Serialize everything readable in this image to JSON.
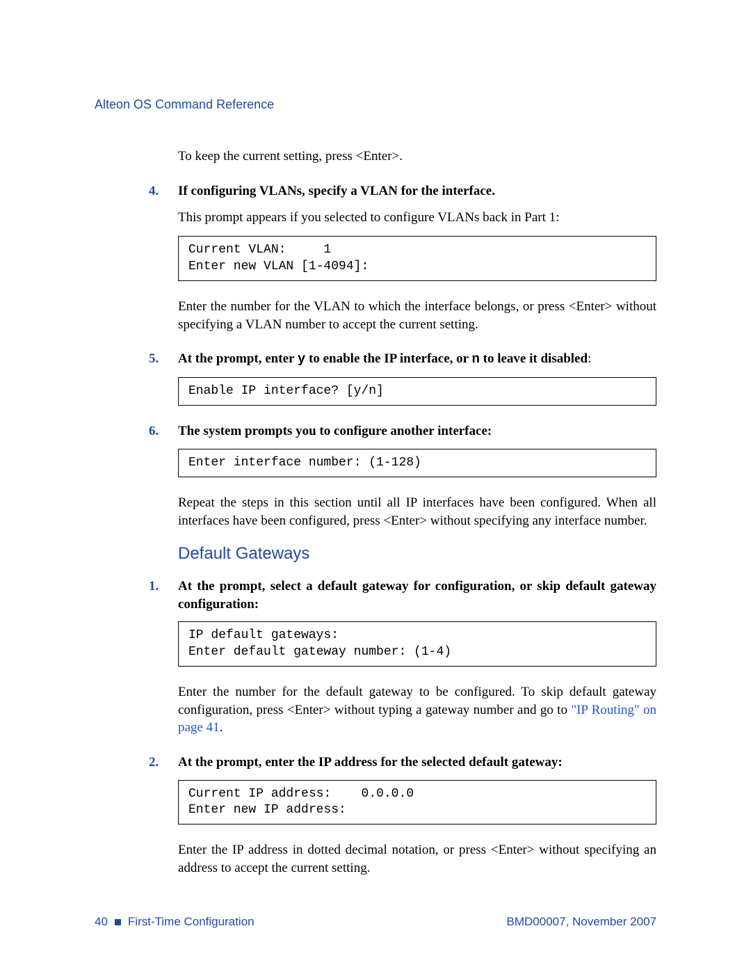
{
  "header": {
    "doc_title": "Alteon OS Command Reference"
  },
  "intro_line": "To keep the current setting, press <Enter>.",
  "steps_a": [
    {
      "num": "4.",
      "title": "If configuring VLANs, specify a VLAN for the interface.",
      "desc1": "This prompt appears if you selected to configure VLANs back in Part 1:",
      "code": "Current VLAN:     1\nEnter new VLAN [1-4094]:",
      "desc2": "Enter the number for the VLAN to which the interface belongs, or press <Enter> without specifying a VLAN number to accept the current setting."
    },
    {
      "num": "5.",
      "title_prefix": "At the prompt, enter ",
      "title_mono1": "y",
      "title_mid": " to enable the IP interface, or ",
      "title_mono2": "n",
      "title_suffix": " to leave it disabled",
      "title_colon": ":",
      "code": "Enable IP interface? [y/n]"
    },
    {
      "num": "6.",
      "title": "The system prompts you to configure another interface:",
      "code": "Enter interface number: (1-128)",
      "desc2": "Repeat the steps in this section until all IP interfaces have been configured. When all interfaces have been configured, press <Enter> without specifying any interface number."
    }
  ],
  "section_heading": "Default Gateways",
  "steps_b": [
    {
      "num": "1.",
      "title": "At the prompt, select a default gateway for configuration, or skip default gateway configuration:",
      "code": "IP default gateways:\nEnter default gateway number: (1-4)",
      "desc2_prefix": "Enter the number for the default gateway to be configured. To skip default gateway configuration, press <Enter> without typing a gateway number and go to ",
      "desc2_link": "\"IP Routing\" on page 41",
      "desc2_suffix": "."
    },
    {
      "num": "2.",
      "title": "At the prompt, enter the IP address for the selected default gateway:",
      "code": "Current IP address:    0.0.0.0\nEnter new IP address:",
      "desc2": "Enter the IP address in dotted decimal notation, or press <Enter> without specifying an address to accept the current setting."
    }
  ],
  "footer": {
    "page_num": "40",
    "chapter": "First-Time Configuration",
    "doc_id": "BMD00007, November 2007"
  }
}
